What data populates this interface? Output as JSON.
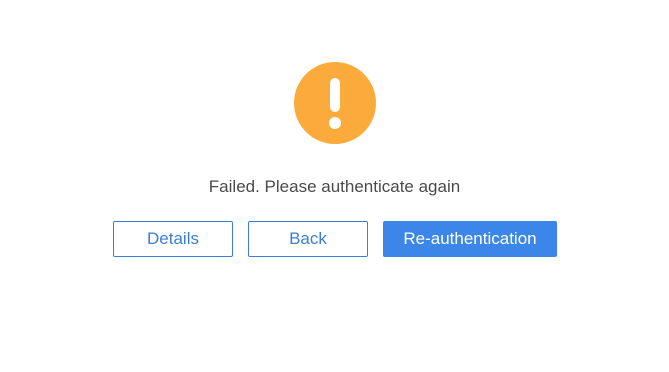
{
  "dialog": {
    "status_icon": "warning-exclamation-icon",
    "message": "Failed. Please authenticate again",
    "colors": {
      "warning": "#fbaa3c",
      "primary": "#3b86e8",
      "outline": "#3a7fd4",
      "text": "#4a4a4a"
    },
    "buttons": {
      "details_label": "Details",
      "back_label": "Back",
      "reauth_label": "Re-authentication"
    }
  }
}
